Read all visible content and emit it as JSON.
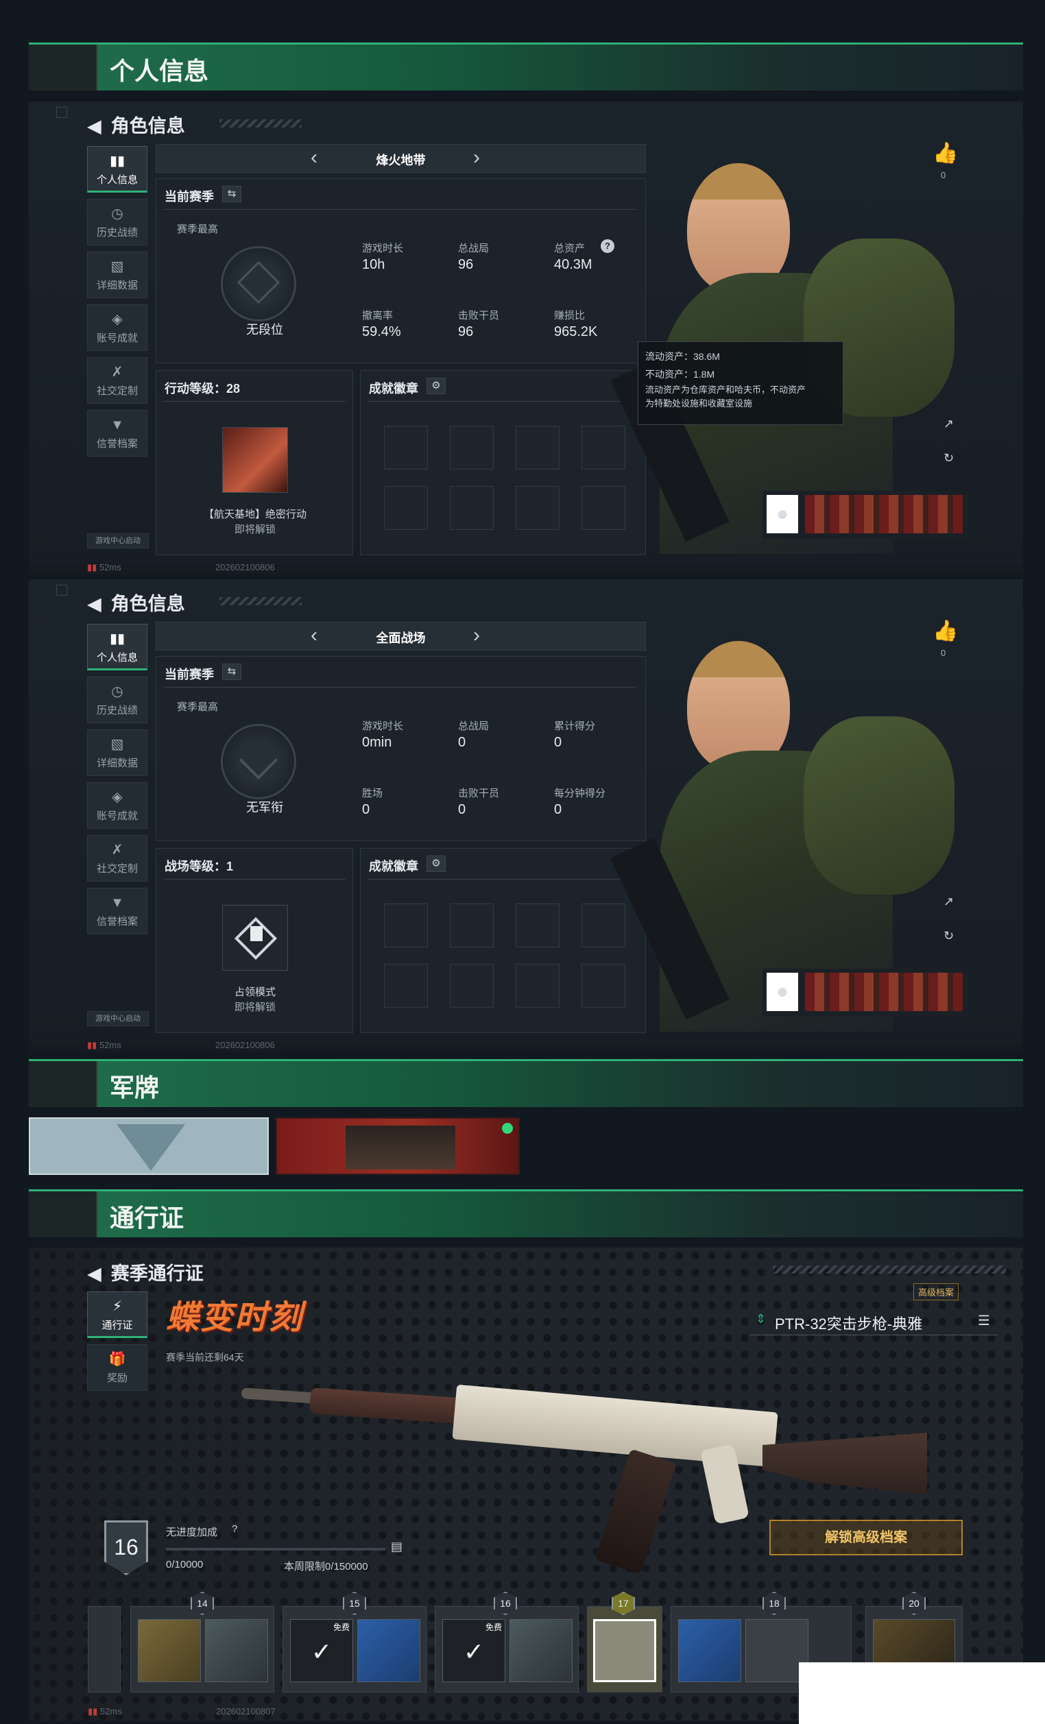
{
  "sections": {
    "personal": "个人信息",
    "dogtag": "军牌",
    "pass": "通行证"
  },
  "sidebar": [
    {
      "label": "个人信息",
      "icon": "bar-chart-icon"
    },
    {
      "label": "历史战绩",
      "icon": "history-icon"
    },
    {
      "label": "详细数据",
      "icon": "folder-icon"
    },
    {
      "label": "账号成就",
      "icon": "medal-icon"
    },
    {
      "label": "社交定制",
      "icon": "tools-icon"
    },
    {
      "label": "信誉档案",
      "icon": "shield-icon"
    }
  ],
  "panel1": {
    "title": "角色信息",
    "mode": "烽火地带",
    "season_label": "当前赛季",
    "season_best": "赛季最高",
    "rank": "无段位",
    "stats": [
      {
        "label": "游戏时长",
        "value": "10h"
      },
      {
        "label": "总战局",
        "value": "96"
      },
      {
        "label": "总资产",
        "value": "40.3M"
      },
      {
        "label": "撤离率",
        "value": "59.4%"
      },
      {
        "label": "击败干员",
        "value": "96"
      },
      {
        "label": "赚损比",
        "value": "965.2K"
      }
    ],
    "tooltip": {
      "line1": "流动资产：38.6M",
      "line2": "不动资产：1.8M",
      "line3": "流动资产为仓库资产和哈夫币，不动资产",
      "line4": "为特勤处设施和收藏室设施"
    },
    "level_label": "行动等级：28",
    "level_item": "【航天基地】绝密行动",
    "level_sub": "即将解锁",
    "badge_label": "成就徽章",
    "likes": "0",
    "footer_game": "游戏中心启动",
    "ping": "52ms",
    "code": "202602100806"
  },
  "panel2": {
    "title": "角色信息",
    "mode": "全面战场",
    "season_label": "当前赛季",
    "season_best": "赛季最高",
    "rank": "无军衔",
    "stats": [
      {
        "label": "游戏时长",
        "value": "0min"
      },
      {
        "label": "总战局",
        "value": "0"
      },
      {
        "label": "累计得分",
        "value": "0"
      },
      {
        "label": "胜场",
        "value": "0"
      },
      {
        "label": "击败干员",
        "value": "0"
      },
      {
        "label": "每分钟得分",
        "value": "0"
      }
    ],
    "level_label": "战场等级：1",
    "level_item": "占领模式",
    "level_sub": "即将解锁",
    "badge_label": "成就徽章",
    "likes": "0",
    "footer_game": "游戏中心启动",
    "ping": "52ms",
    "code": "202602100806"
  },
  "pass": {
    "title": "赛季通行证",
    "tab1": "通行证",
    "tab2": "奖励",
    "logo": "蝶变时刻",
    "remaining": "赛季当前还剩64天",
    "tier_tag": "高级档案",
    "weapon": "PTR-32突击步枪-典雅",
    "level": "16",
    "boost": "无进度加成",
    "boost_q": "?",
    "progress": "0/10000",
    "weekly": "本周限制0/150000",
    "unlock": "解锁高级档案",
    "free": "免费",
    "levels": [
      "14",
      "15",
      "16",
      "17",
      "18",
      "20"
    ],
    "ping": "52ms",
    "code": "202602100807"
  },
  "colors": {
    "accent": "#2fb277",
    "gold": "#f2c56a"
  }
}
